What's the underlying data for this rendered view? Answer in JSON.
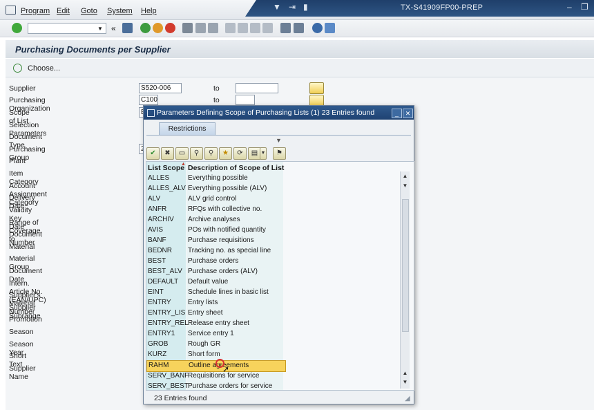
{
  "menu": [
    "Program",
    "Edit",
    "Goto",
    "System",
    "Help"
  ],
  "system_name": "TX-S41909FP00-PREP",
  "page_title": "Purchasing Documents per Supplier",
  "choose_label": "Choose...",
  "to_label": "to",
  "fields": [
    {
      "label": "Supplier",
      "value": "S520-006"
    },
    {
      "label": "Purchasing Organization",
      "value": "C100"
    },
    {
      "label": "Scope of List",
      "value": "B"
    },
    {
      "label": "Selection Parameters",
      "value": ""
    },
    {
      "label": "Document Type",
      "value": ""
    },
    {
      "label": "Purchasing Group",
      "value": "2"
    },
    {
      "label": "Plant",
      "value": ""
    },
    {
      "label": "Item Category",
      "value": ""
    },
    {
      "label": "Account Assignment Category",
      "value": ""
    },
    {
      "label": "Delivery Date",
      "value": ""
    },
    {
      "label": "Validity Key Date",
      "value": ""
    },
    {
      "label": "Range of Coverage to",
      "value": ""
    },
    {
      "label": "Document Number",
      "value": ""
    },
    {
      "label": "Material",
      "value": ""
    },
    {
      "label": "Material Group",
      "value": ""
    },
    {
      "label": "Document Date",
      "value": ""
    },
    {
      "label": "Intern. Article No. (EAN/UPC)",
      "value": ""
    },
    {
      "label": "Supplier's Material Number",
      "value": ""
    },
    {
      "label": "Supplier Subrange",
      "value": ""
    },
    {
      "label": "Promotion",
      "value": ""
    },
    {
      "label": "Season",
      "value": ""
    },
    {
      "label": "Season Year",
      "value": ""
    },
    {
      "label": "Short Text",
      "value": ""
    },
    {
      "label": "Supplier Name",
      "value": ""
    }
  ],
  "dialog": {
    "title": "Parameters Defining Scope of Purchasing Lists (1)   23 Entries found",
    "tab": "Restrictions",
    "col_headers": [
      "List Scope",
      "Description of Scope of List"
    ],
    "rows": [
      [
        "ALLES",
        "Everything possible"
      ],
      [
        "ALLES_ALV",
        "Everything possible (ALV)"
      ],
      [
        "ALV",
        "ALV grid control"
      ],
      [
        "ANFR",
        "RFQs with collective no."
      ],
      [
        "ARCHIV",
        "Archive analyses"
      ],
      [
        "AVIS",
        "POs with notified quantity"
      ],
      [
        "BANF",
        "Purchase requisitions"
      ],
      [
        "BEDNR",
        "Tracking no. as special line"
      ],
      [
        "BEST",
        "Purchase orders"
      ],
      [
        "BEST_ALV",
        "Purchase orders (ALV)"
      ],
      [
        "DEFAULT",
        "Default value"
      ],
      [
        "EINT",
        "Schedule lines in basic list"
      ],
      [
        "ENTRY",
        "Entry lists"
      ],
      [
        "ENTRY_LIS",
        "Entry sheet"
      ],
      [
        "ENTRY_REL",
        "Release entry sheet"
      ],
      [
        "ENTRY1",
        "Service entry 1"
      ],
      [
        "GROB",
        "Rough GR"
      ],
      [
        "KURZ",
        "Short form"
      ],
      [
        "RAHM",
        "Outline agreements"
      ],
      [
        "SERV_BANF",
        "Requisitions for service"
      ],
      [
        "SERV_BEST",
        "Purchase orders for service"
      ]
    ],
    "selected_row": "RAHM",
    "status": "23 Entries found"
  },
  "colors": {
    "title_band": "#1f3f6a",
    "selection": "#f7d35c",
    "list_scope_col": "#d5ecef"
  }
}
